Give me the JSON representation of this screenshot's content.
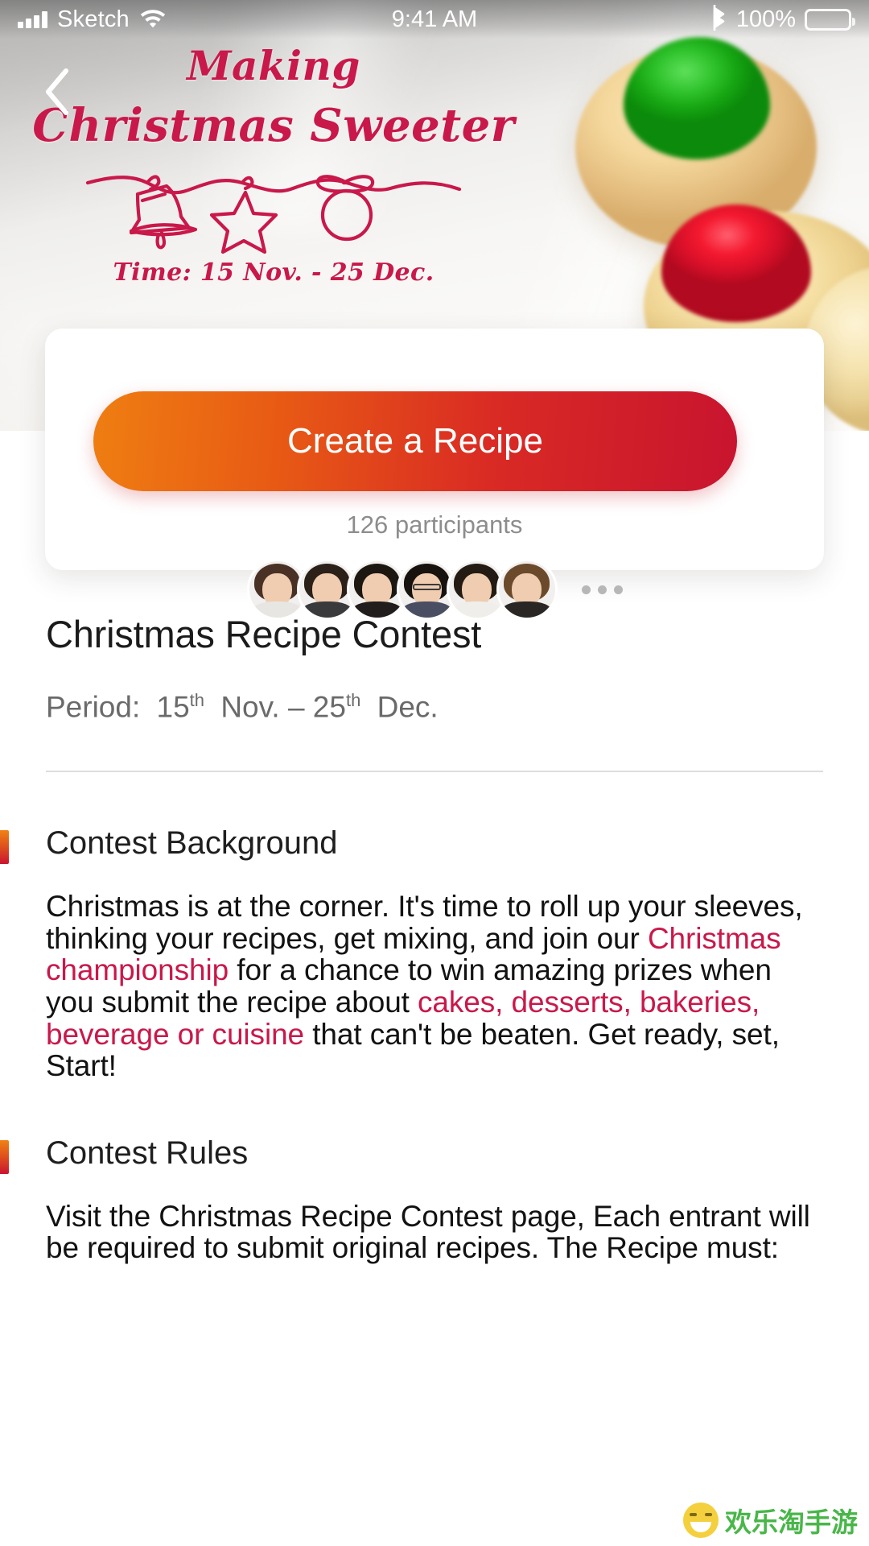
{
  "statusbar": {
    "carrier": "Sketch",
    "time": "9:41 AM",
    "battery_pct": "100%",
    "signal_icon": "signal-bars-icon",
    "wifi_icon": "wifi-icon",
    "bluetooth_icon": "bluetooth-icon",
    "battery_icon": "battery-full-icon"
  },
  "hero": {
    "back_icon": "chevron-left-icon",
    "title_line1": "Making",
    "title_line2": "Christmas Sweeter",
    "garland_icon": "garland-bell-star-ornament-icon",
    "time_label": "Time: 15 Nov. - 25 Dec.",
    "accent_color": "#c9184a"
  },
  "card": {
    "cta_label": "Create a Recipe",
    "cta_gradient_from": "#ef7e12",
    "cta_gradient_to": "#c8142f",
    "participants_label": "126 participants",
    "participants_count": 126,
    "avatars": [
      {
        "name": "avatar-1",
        "hair": "#4a3126",
        "body": "#e8e6e2"
      },
      {
        "name": "avatar-2",
        "hair": "#2b2118",
        "body": "#3a3a3c"
      },
      {
        "name": "avatar-3",
        "hair": "#1d1712",
        "body": "#201d1c"
      },
      {
        "name": "avatar-4",
        "hair": "#17120e",
        "body": "#4a4e63",
        "glasses": true
      },
      {
        "name": "avatar-5",
        "hair": "#241c14",
        "body": "#f0eeea"
      },
      {
        "name": "avatar-6",
        "hair": "#6b4a2c",
        "body": "#2a2624"
      }
    ],
    "more_icon": "more-dots-icon"
  },
  "main": {
    "page_title": "Christmas Recipe Contest",
    "period": {
      "prefix": "Period:",
      "start_day": "15",
      "start_ord": "th",
      "start_month": "Nov.",
      "dash": "–",
      "end_day": "25",
      "end_ord": "th",
      "end_month": "Dec."
    },
    "sections": [
      {
        "title": "Contest Background",
        "body_parts": [
          {
            "text": "Christmas is at the corner. It's time to roll up your sleeves, thinking your recipes, get mixing, and join our ",
            "highlight": false
          },
          {
            "text": "Christmas championship",
            "highlight": true
          },
          {
            "text": " for a chance to win amazing prizes when you submit the recipe about ",
            "highlight": false
          },
          {
            "text": "cakes, desserts, bakeries, beverage or cuisine",
            "highlight": true
          },
          {
            "text": "  that can't be beaten. Get ready, set, Start!",
            "highlight": false
          }
        ]
      },
      {
        "title": "Contest Rules",
        "body_parts": [
          {
            "text": "Visit the Christmas Recipe Contest page, Each entrant will be required to submit original recipes. The Recipe must:",
            "highlight": false
          }
        ]
      }
    ]
  },
  "watermark": {
    "text": "欢乐淘手游",
    "icon": "smiley-face-icon",
    "color": "#49b649"
  }
}
